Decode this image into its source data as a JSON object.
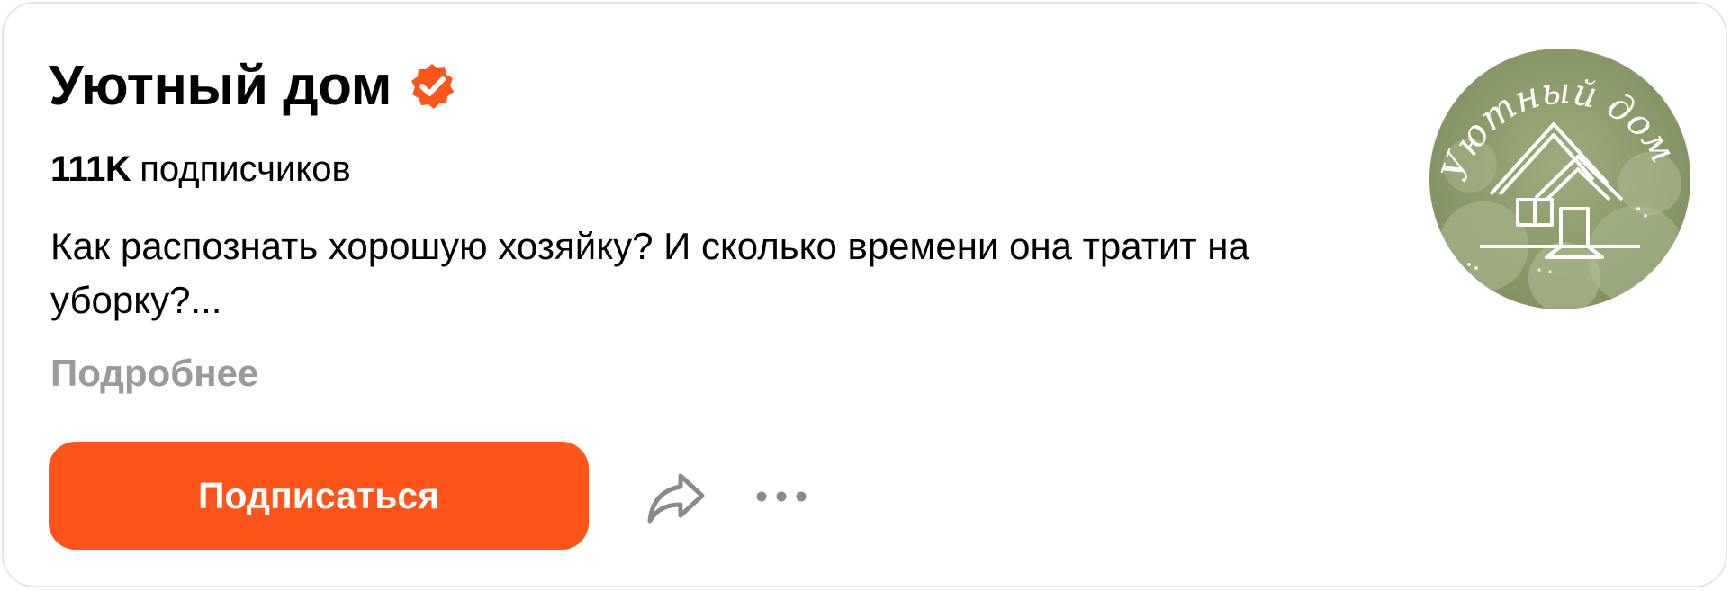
{
  "channel": {
    "name": "Уютный дом",
    "verified_icon": "verified-check-icon",
    "subscribers_count": "111K",
    "subscribers_label": "подписчиков",
    "description": "Как распознать хорошую хозяйку? И сколько времени она тратит на уборку?...",
    "more_link": "Подробнее",
    "avatar_text": "Уютный дом"
  },
  "actions": {
    "subscribe_label": "Подписаться",
    "share_icon": "share-arrow-icon",
    "more_icon": "more-horizontal-icon"
  },
  "colors": {
    "accent": "#ff5419",
    "muted_text": "#9a9a9a",
    "text": "#000000",
    "avatar_green": "#8a9a6a"
  }
}
